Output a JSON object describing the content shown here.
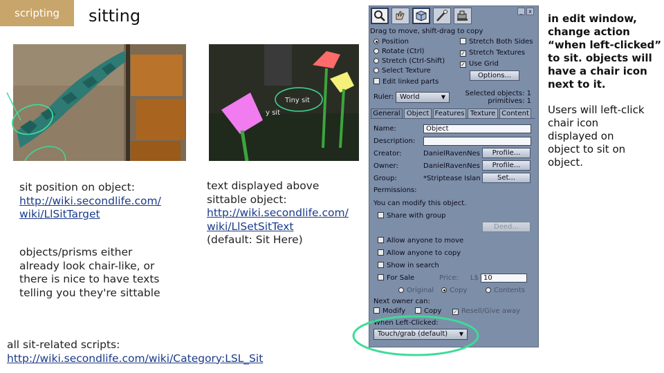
{
  "slide": {
    "badge": "scripting",
    "title": "sitting"
  },
  "left_column": {
    "sit_target_text": "sit position on object:",
    "sit_target_link_1": "http://wiki.secondlife.com/",
    "sit_target_link_2": "wiki/LlSitTarget",
    "prisms_text_1": "objects/prisms either",
    "prisms_text_2": "already look chair-like, or",
    "prisms_text_3": "there is nice to have texts",
    "prisms_text_4": "telling you they're sittable",
    "all_scripts_text": "all sit-related scripts:",
    "all_scripts_link": "http://wiki.secondlife.com/wiki/Category:LSL_Sit"
  },
  "middle_column": {
    "photo_label_1": "Tiny sit",
    "photo_label_2": "y sit",
    "line1": "text displayed above",
    "line2": "sittable object:",
    "link1": "http://wiki.secondlife.com/",
    "link2": "wiki/LlSetSitText",
    "note": "(default: Sit Here)"
  },
  "right_column": {
    "heading_1": "in edit window,",
    "heading_2": "change action",
    "heading_3": "“when left-clicked”",
    "heading_4": "to sit. objects will",
    "heading_5": "have a chair icon",
    "heading_6": "next to it.",
    "body_1": "Users will left-click",
    "body_2": "chair icon",
    "body_3": "displayed on",
    "body_4": "object to sit on",
    "body_5": "object."
  },
  "dialog": {
    "window_minimize": "_",
    "window_close": "x",
    "hint": "Drag to move, shift-drag to copy",
    "radio_position": "Position",
    "radio_rotate": "Rotate (Ctrl)",
    "radio_stretch": "Stretch (Ctrl-Shift)",
    "radio_select_texture": "Select Texture",
    "check_stretch_both": "Stretch Both Sides",
    "check_stretch_textures": "Stretch Textures",
    "check_use_grid": "Use Grid",
    "options_button": "Options...",
    "check_edit_linked": "Edit linked parts",
    "ruler_label": "Ruler:",
    "ruler_value": "World",
    "selected_objects": "Selected objects: 1",
    "primitives": "primitives: 1",
    "tabs": [
      "General",
      "Object",
      "Features",
      "Texture",
      "Content"
    ],
    "name_label": "Name:",
    "name_value": "Object",
    "description_label": "Description:",
    "description_value": "",
    "creator_label": "Creator:",
    "creator_value": "DanielRavenNes",
    "owner_label": "Owner:",
    "owner_value": "DanielRavenNes",
    "group_label": "Group:",
    "group_value": "*Striptease Islan",
    "profile_button": "Profile...",
    "set_button": "Set...",
    "permissions_label": "Permissions:",
    "modify_note": "You can modify this object.",
    "share_with_group": "Share with group",
    "deed_button": "Deed...",
    "allow_move": "Allow anyone to move",
    "allow_copy": "Allow anyone to copy",
    "show_in_search": "Show in search",
    "for_sale": "For Sale",
    "price_label": "Price:",
    "currency": "L$",
    "price_value": "10",
    "sale_original": "Original",
    "sale_copy": "Copy",
    "sale_contents": "Contents",
    "next_owner_label": "Next owner can:",
    "next_modify": "Modify",
    "next_copy": "Copy",
    "next_resell": "Resell/Give away",
    "left_click_label": "When Left-Clicked:",
    "left_click_value": "Touch/grab (default)"
  },
  "colors": {
    "badge": "#c8a56a",
    "highlight_circle": "#3ddc97",
    "dialog_bg": "#7d8ea8",
    "link": "#1a3a8a"
  }
}
